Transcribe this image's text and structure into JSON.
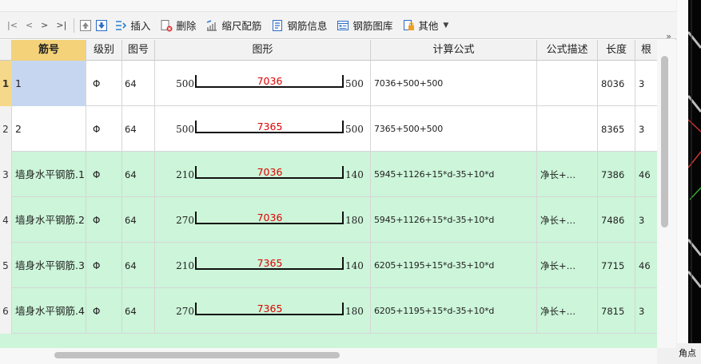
{
  "toolbar": {
    "nav": [
      "|<",
      "<",
      ">",
      ">|"
    ],
    "insert": "插入",
    "delete": "删除",
    "scale": "缩尺配筋",
    "rebar_info": "钢筋信息",
    "rebar_lib": "钢筋图库",
    "other": "其他",
    "more": "»"
  },
  "columns": [
    "筋号",
    "级别",
    "图号",
    "图形",
    "计算公式",
    "公式描述",
    "长度",
    "根"
  ],
  "rows": [
    {
      "num": "1",
      "name": "1",
      "grade": "Φ",
      "fig": "64",
      "left": "500",
      "mid": "7036",
      "right": "500",
      "formula": "7036+500+500",
      "desc": "",
      "length": "8036",
      "count": "3"
    },
    {
      "num": "2",
      "name": "2",
      "grade": "Φ",
      "fig": "64",
      "left": "500",
      "mid": "7365",
      "right": "500",
      "formula": "7365+500+500",
      "desc": "",
      "length": "8365",
      "count": "3"
    },
    {
      "num": "3",
      "name": "墙身水平钢筋.1",
      "grade": "Φ",
      "fig": "64",
      "left": "210",
      "mid": "7036",
      "right": "140",
      "formula": "5945+1126+15*d-35+10*d",
      "desc": "净长+…",
      "length": "7386",
      "count": "46"
    },
    {
      "num": "4",
      "name": "墙身水平钢筋.2",
      "grade": "Φ",
      "fig": "64",
      "left": "270",
      "mid": "7036",
      "right": "180",
      "formula": "5945+1126+15*d-35+10*d",
      "desc": "净长+…",
      "length": "7486",
      "count": "3"
    },
    {
      "num": "5",
      "name": "墙身水平钢筋.3",
      "grade": "Φ",
      "fig": "64",
      "left": "210",
      "mid": "7365",
      "right": "140",
      "formula": "6205+1195+15*d-35+10*d",
      "desc": "净长+…",
      "length": "7715",
      "count": "46"
    },
    {
      "num": "6",
      "name": "墙身水平钢筋.4",
      "grade": "Φ",
      "fig": "64",
      "left": "270",
      "mid": "7365",
      "right": "180",
      "formula": "6205+1195+15*d-35+10*d",
      "desc": "净长+…",
      "length": "7815",
      "count": "3"
    }
  ],
  "right_pane_label": "角点"
}
